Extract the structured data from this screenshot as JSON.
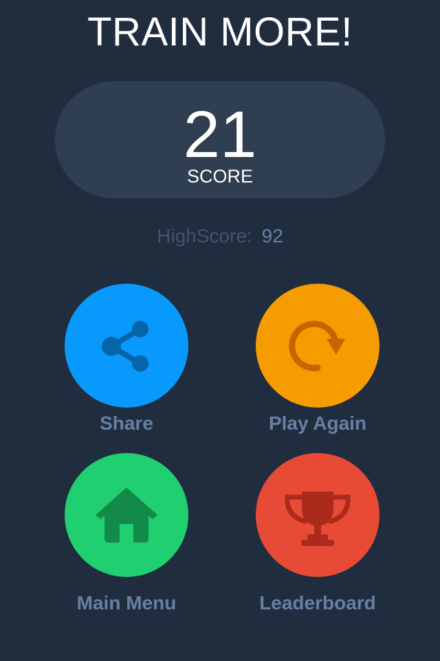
{
  "header": {
    "title": "TRAIN MORE!"
  },
  "score": {
    "value": "21",
    "label": "SCORE"
  },
  "highscore": {
    "label": "HighScore:",
    "value": "92"
  },
  "actions": [
    {
      "label": "Share",
      "icon": "share-icon",
      "color": "#0899fd"
    },
    {
      "label": "Play Again",
      "icon": "replay-icon",
      "color": "#f59c00"
    },
    {
      "label": "Main Menu",
      "icon": "home-icon",
      "color": "#1fcf70"
    },
    {
      "label": "Leaderboard",
      "icon": "trophy-icon",
      "color": "#e84b35"
    }
  ],
  "colors": {
    "background": "#202d3f",
    "panel": "#2f3e50",
    "label": "#6680a2",
    "muted": "#42546a"
  }
}
